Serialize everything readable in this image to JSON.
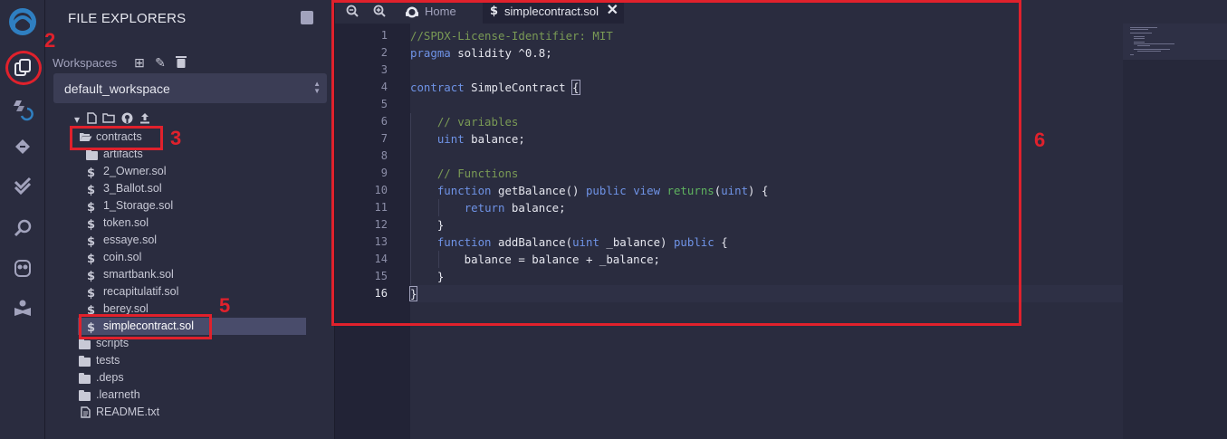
{
  "file_explorer": {
    "title": "FILE EXPLORERS",
    "workspaces_label": "Workspaces",
    "selected_workspace": "default_workspace",
    "tree": [
      {
        "label": "contracts",
        "kind": "folder-open"
      },
      {
        "label": "artifacts",
        "kind": "folder"
      },
      {
        "label": "2_Owner.sol",
        "kind": "sol"
      },
      {
        "label": "3_Ballot.sol",
        "kind": "sol"
      },
      {
        "label": "1_Storage.sol",
        "kind": "sol"
      },
      {
        "label": "token.sol",
        "kind": "sol"
      },
      {
        "label": "essaye.sol",
        "kind": "sol"
      },
      {
        "label": "coin.sol",
        "kind": "sol"
      },
      {
        "label": "smartbank.sol",
        "kind": "sol"
      },
      {
        "label": "recapitulatif.sol",
        "kind": "sol"
      },
      {
        "label": "berey.sol",
        "kind": "sol"
      },
      {
        "label": "simplecontract.sol",
        "kind": "sol",
        "selected": true
      },
      {
        "label": "scripts",
        "kind": "folder"
      },
      {
        "label": "tests",
        "kind": "folder"
      },
      {
        "label": ".deps",
        "kind": "folder"
      },
      {
        "label": ".learneth",
        "kind": "folder"
      },
      {
        "label": "README.txt",
        "kind": "file"
      }
    ]
  },
  "editor": {
    "tabs": [
      {
        "label": "Home",
        "active": false
      },
      {
        "label": "simplecontract.sol",
        "active": true
      }
    ],
    "line_numbers": [
      "1",
      "2",
      "3",
      "4",
      "5",
      "6",
      "7",
      "8",
      "9",
      "10",
      "11",
      "12",
      "13",
      "14",
      "15",
      "16"
    ],
    "active_line": 16,
    "code": [
      "//SPDX-License-Identifier: MIT",
      "pragma solidity ^0.8;",
      "",
      "contract SimpleContract {",
      "",
      "    // variables",
      "    uint balance;",
      "",
      "    // Functions",
      "    function getBalance() public view returns(uint) {",
      "        return balance;",
      "    }",
      "    function addBalance(uint _balance) public {",
      "        balance = balance + _balance;",
      "    }",
      "}"
    ]
  },
  "annotations": {
    "labels": [
      "2",
      "3",
      "5",
      "6"
    ]
  },
  "colors": {
    "annotation_red": "#e0212c",
    "comment_green": "#7a9a55",
    "keyword_blue": "#6f93e6",
    "returns_green": "#5fb35f"
  }
}
